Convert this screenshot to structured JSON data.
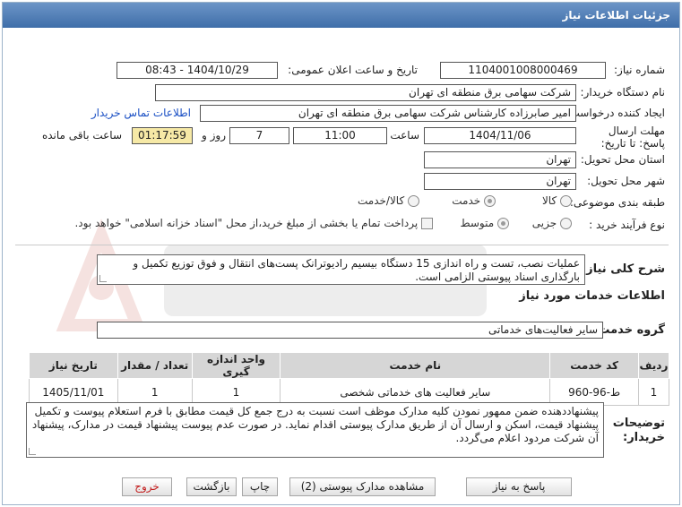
{
  "title": "جزئیات اطلاعات نیاز",
  "fields": {
    "need_number_label": "شماره نیاز:",
    "need_number": "1104001008000469",
    "announce_label": "تاریخ و ساعت اعلان عمومی:",
    "announce_value": "1404/10/29 - 08:43",
    "buyer_org_label": "نام دستگاه خریدار:",
    "buyer_org": "شرکت سهامی برق منطقه ای تهران",
    "creator_label": "ایجاد کننده درخواست:",
    "creator": "امیر صابرزاده کارشناس شرکت سهامی برق منطقه ای تهران",
    "contact_link": "اطلاعات تماس خریدار",
    "deadline_label": "مهلت ارسال پاسخ: تا تاریخ:",
    "deadline_date": "1404/11/06",
    "time_label": "ساعت",
    "deadline_time": "11:00",
    "days_value": "7",
    "days_label": "روز و",
    "remaining_time": "01:17:59",
    "remaining_label": "ساعت باقی مانده",
    "province_label": "استان محل تحویل:",
    "province": "تهران",
    "city_label": "شهر محل تحویل:",
    "city": "تهران",
    "category_label": "طبقه بندی موضوعی:",
    "category_options": [
      "کالا",
      "خدمت",
      "کالا/خدمت"
    ],
    "process_label": "نوع فرآیند خرید :",
    "process_options": [
      "جزیی",
      "متوسط"
    ],
    "treasury_note": "پرداخت تمام یا بخشی از مبلغ خرید،از محل \"اسناد خزانه اسلامی\" خواهد بود."
  },
  "description": {
    "label": "شرح کلی نیاز:",
    "text": "عملیات نصب، تست و راه اندازی 15 دستگاه بیسیم رادیوترانک پست‌های انتقال و فوق توزیع تکمیل و بارگذاری اسناد پیوستی الزامی است."
  },
  "services": {
    "section_title": "اطلاعات خدمات مورد نیاز",
    "group_label": "گروه خدمت:",
    "group_value": "سایر فعالیت‌های خدماتی",
    "columns": [
      "ردیف",
      "کد خدمت",
      "نام خدمت",
      "واحد اندازه گیری",
      "تعداد / مقدار",
      "تاریخ نیاز"
    ],
    "rows": [
      [
        "1",
        "ط-96-960",
        "سایر فعالیت های خدماتی شخصی",
        "1",
        "1",
        "1405/11/01"
      ]
    ]
  },
  "buyer_notes": {
    "label": "توضیحات خریدار:",
    "text": "پیشنهاددهنده ضمن ممهور نمودن کلیه مدارک موظف است نسبت به درج جمع کل قیمت مطابق با فرم استعلام پیوست و تکمیل پیشنهاد قیمت، اسکن و ارسال آن از طریق مدارک پیوستی اقدام نماید. در صورت عدم پیوست پیشنهاد قیمت در مدارک، پیشنهاد آن شرکت مردود اعلام می‌گردد."
  },
  "buttons": {
    "reply": "پاسخ به نیاز",
    "attachments": "مشاهده مدارک پیوستی (2)",
    "print": "چاپ",
    "back": "بازگشت",
    "exit": "خروج"
  },
  "colors": {
    "title_bar": "#4a78b0",
    "link": "#1a4fc4",
    "remaining_bg": "#f6e9a6",
    "exit_text": "#c21b1b"
  }
}
